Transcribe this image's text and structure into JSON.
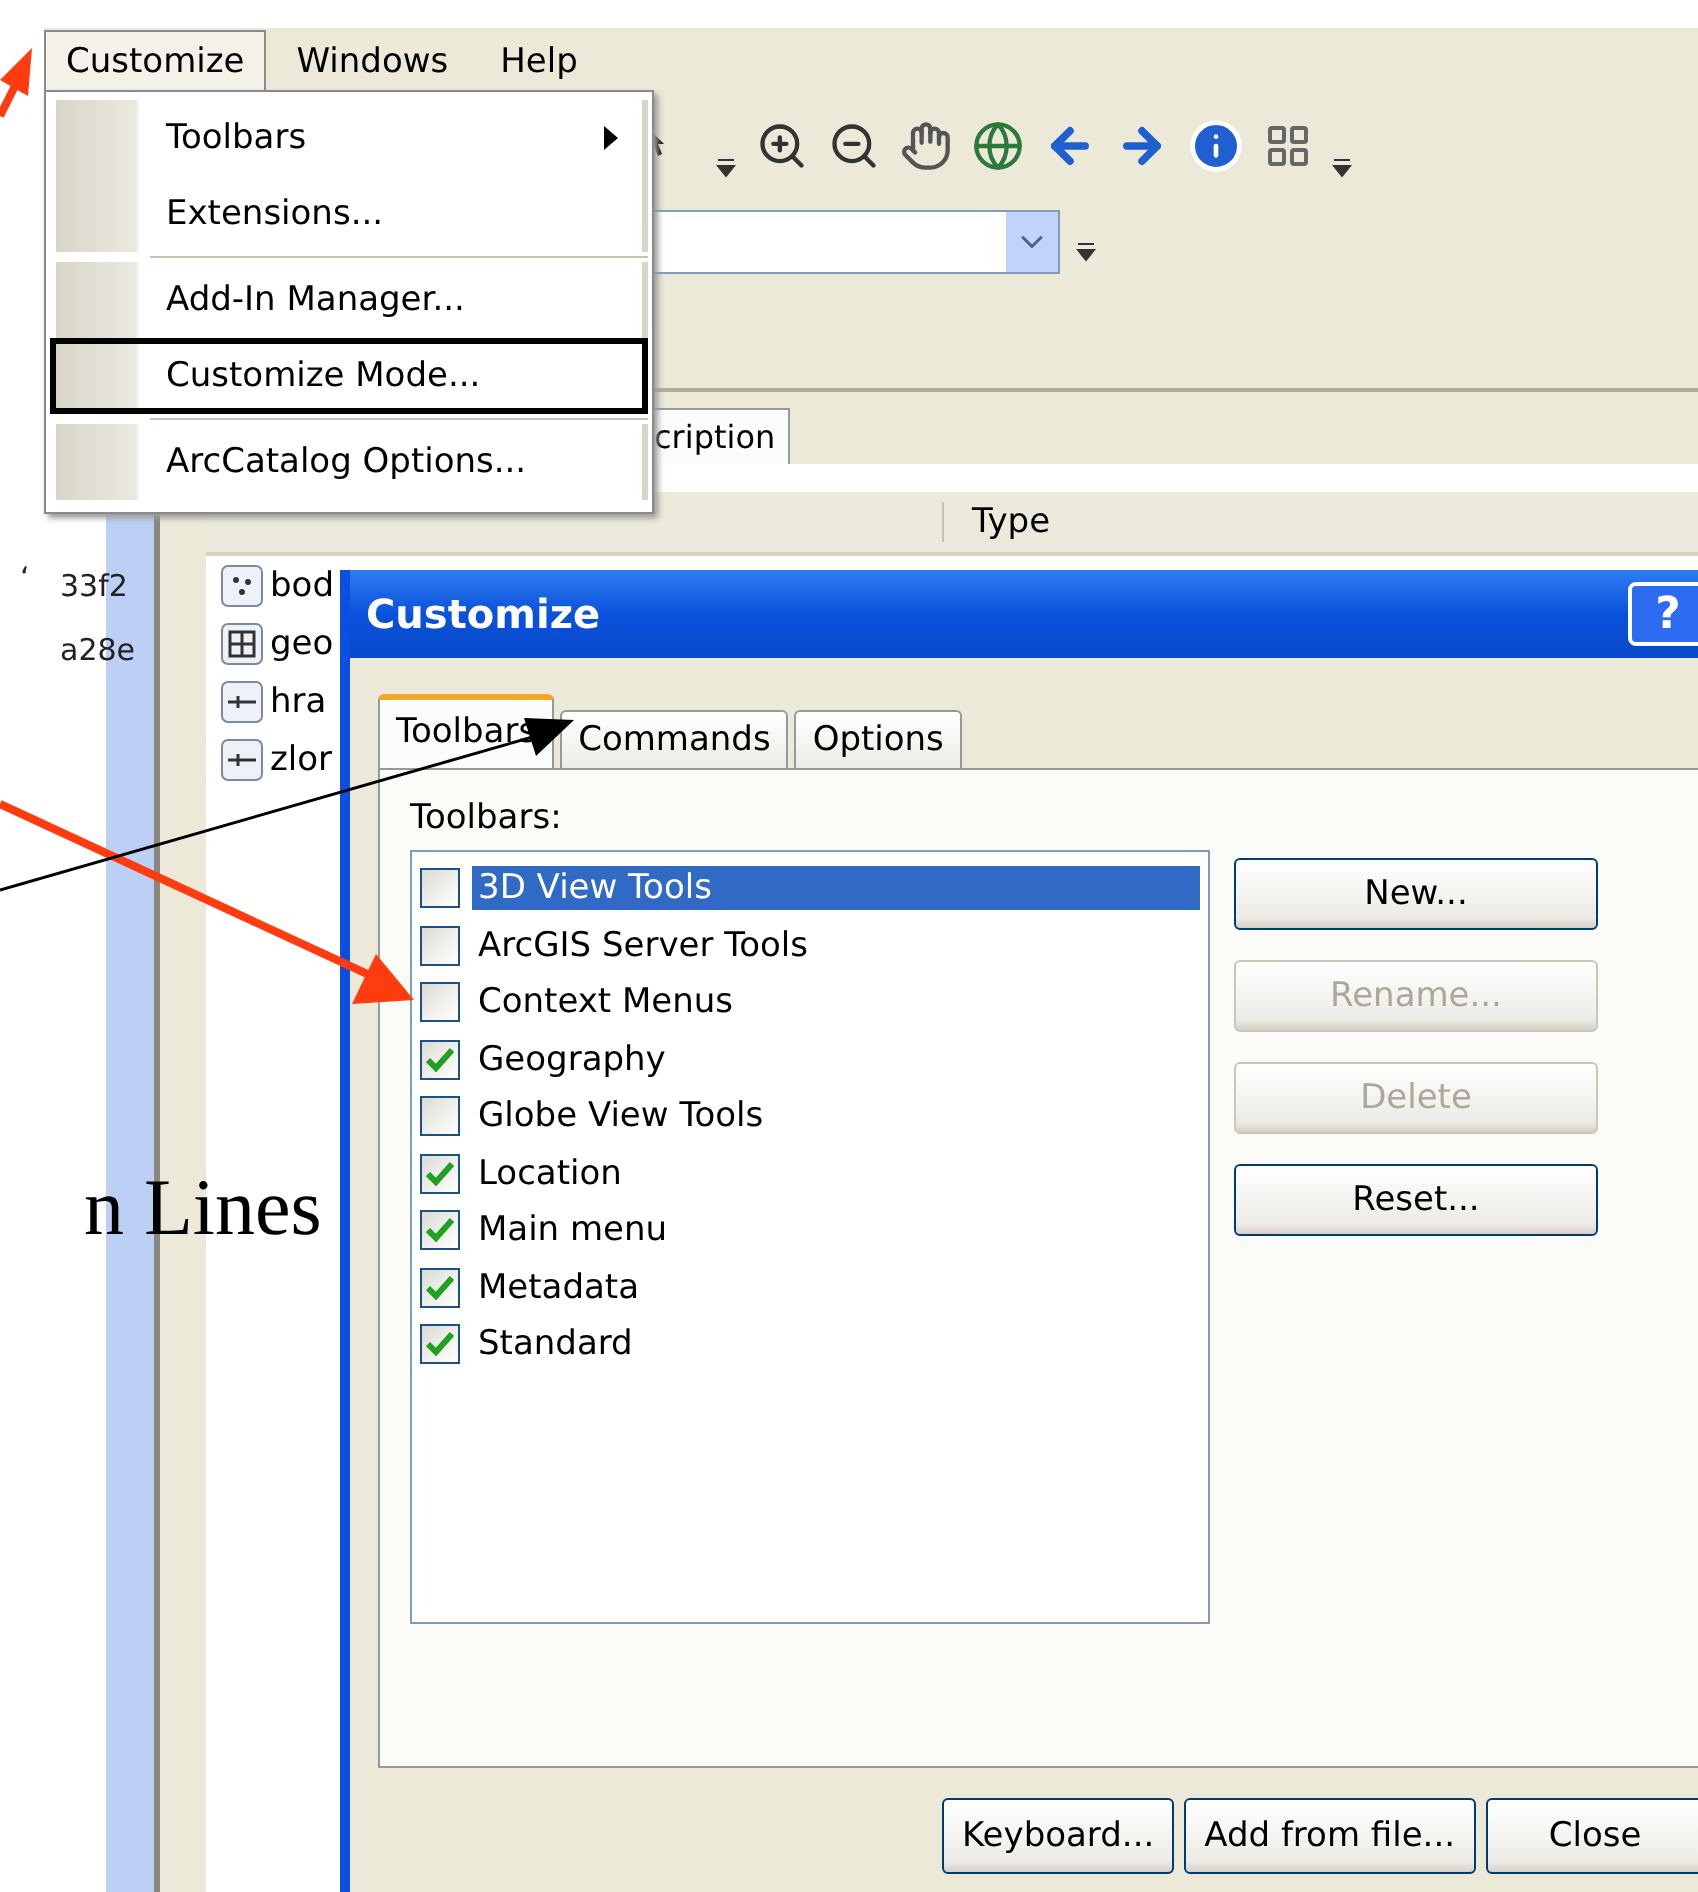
{
  "slide_text": {
    "quote": "‘",
    "line_1": "33f2",
    "line_2": "a28e",
    "caption": "n Lines"
  },
  "menu_bar": [
    {
      "label": "Customize",
      "selected": true
    },
    {
      "label": "Windows",
      "selected": false
    },
    {
      "label": "Help",
      "selected": false
    }
  ],
  "customize_menu": [
    {
      "label": "Toolbars",
      "submenu": true,
      "separator_before": false,
      "outlined": false
    },
    {
      "label": "Extensions...",
      "submenu": false,
      "separator_before": false,
      "outlined": false
    },
    {
      "label": "Add-In Manager...",
      "submenu": false,
      "separator_before": true,
      "outlined": false
    },
    {
      "label": "Customize Mode...",
      "submenu": false,
      "separator_before": false,
      "outlined": true
    },
    {
      "label": "ArcCatalog Options...",
      "submenu": false,
      "separator_before": true,
      "outlined": false
    }
  ],
  "view_tab": "cription",
  "contents": {
    "column_2": "Type",
    "rows": [
      {
        "name": "bod",
        "kind": "point"
      },
      {
        "name": "geo",
        "kind": "polygon"
      },
      {
        "name": "hra",
        "kind": "line"
      },
      {
        "name": "zlor",
        "kind": "line"
      }
    ]
  },
  "dialog": {
    "title": "Customize",
    "help": "?",
    "tabs": [
      {
        "label": "Toolbars",
        "selected": true
      },
      {
        "label": "Commands",
        "selected": false
      },
      {
        "label": "Options",
        "selected": false
      }
    ],
    "list_label": "Toolbars:",
    "toolbars": [
      {
        "label": "3D View Tools",
        "checked": false,
        "selected": true
      },
      {
        "label": "ArcGIS Server Tools",
        "checked": false,
        "selected": false
      },
      {
        "label": "Context Menus",
        "checked": false,
        "selected": false
      },
      {
        "label": "Geography",
        "checked": true,
        "selected": false
      },
      {
        "label": "Globe View Tools",
        "checked": false,
        "selected": false
      },
      {
        "label": "Location",
        "checked": true,
        "selected": false
      },
      {
        "label": "Main menu",
        "checked": true,
        "selected": false
      },
      {
        "label": "Metadata",
        "checked": true,
        "selected": false
      },
      {
        "label": "Standard",
        "checked": true,
        "selected": false
      }
    ],
    "side_buttons": [
      {
        "label": "New...",
        "disabled": false
      },
      {
        "label": "Rename...",
        "disabled": true
      },
      {
        "label": "Delete",
        "disabled": true
      },
      {
        "label": "Reset...",
        "disabled": false
      }
    ],
    "footer_buttons": [
      "Keyboard...",
      "Add from file...",
      "Close"
    ]
  }
}
